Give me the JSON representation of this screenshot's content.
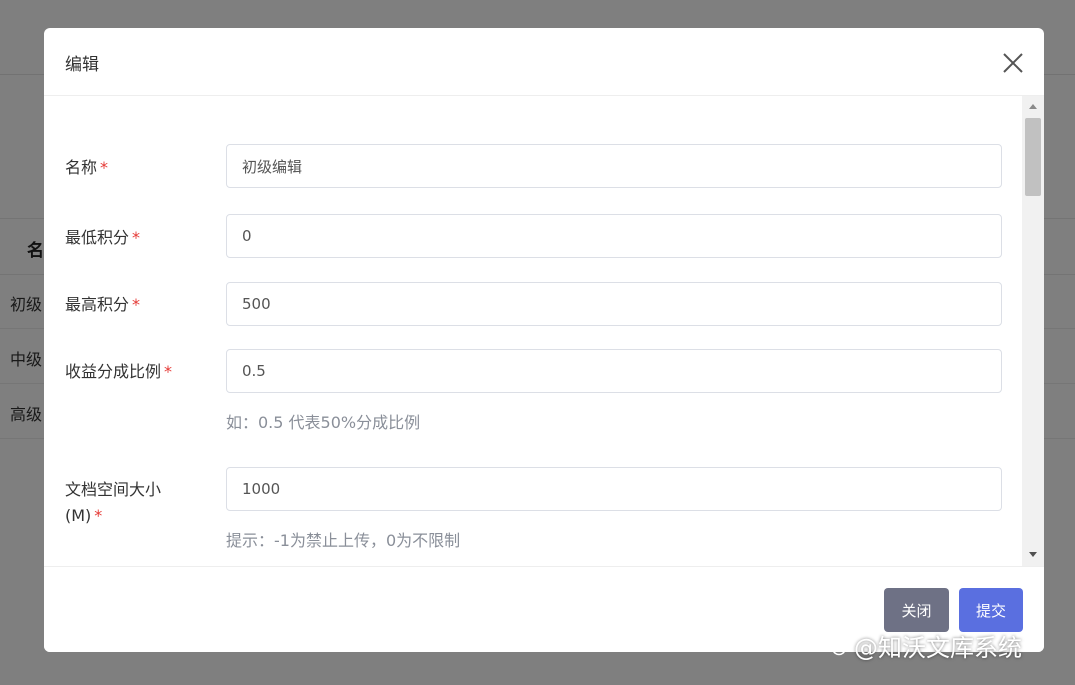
{
  "background": {
    "table_header": "名",
    "rows": [
      "初级",
      "中级",
      "高级"
    ]
  },
  "modal": {
    "title": "编辑",
    "close_icon": "close-icon",
    "fields": [
      {
        "label": "名称",
        "required": "*",
        "value": "初级编辑"
      },
      {
        "label": "最低积分",
        "required": "*",
        "value": "0"
      },
      {
        "label": "最高积分",
        "required": "*",
        "value": "500"
      },
      {
        "label": "收益分成比例",
        "required": "*",
        "value": "0.5",
        "hint": "如：0.5 代表50%分成比例"
      },
      {
        "label": "文档空间大小",
        "label_line2": "(M)",
        "required": "*",
        "value": "1000",
        "hint": "提示：-1为禁止上传，0为不限制"
      },
      {
        "label": "",
        "value": ""
      }
    ],
    "footer": {
      "close_label": "关闭",
      "submit_label": "提交"
    }
  },
  "watermark": {
    "text": "@知沃文库系统"
  },
  "colors": {
    "overlay": "#7f7f7f",
    "required": "#e53935",
    "close_button": "#6e7185",
    "submit_button": "#5a6fe0",
    "hint": "#8a8f99"
  }
}
